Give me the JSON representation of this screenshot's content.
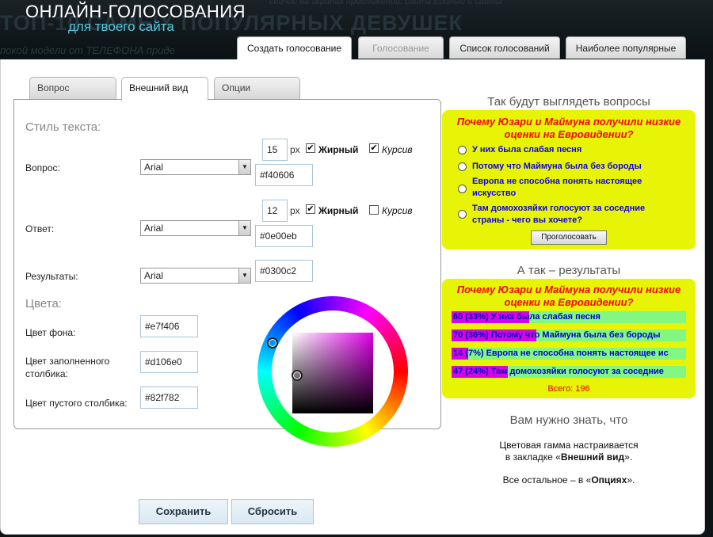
{
  "header": {
    "title": "ОНЛАЙН-ГОЛОСОВАНИЯ",
    "subtitle": "для твоего сайта",
    "bg_text": "ТОП-10 САМЫХ ПОПУЛЯРНЫХ ДЕВУШЕК",
    "bg_text2": "покой модели от ТЕЛЕФОНА приде",
    "bg_text3": "сейчас на экранах предложений: сайта Единый и сайты"
  },
  "top_tabs": [
    {
      "label": "Создать голосование",
      "state": "active"
    },
    {
      "label": "Голосование",
      "state": "disabled"
    },
    {
      "label": "Список голосований",
      "state": "normal"
    },
    {
      "label": "Наиболее популярные",
      "state": "normal"
    }
  ],
  "inner_tabs": [
    {
      "label": "Вопрос"
    },
    {
      "label": "Внешний вид"
    },
    {
      "label": "Опции"
    }
  ],
  "form": {
    "text_style_heading": "Стиль текста:",
    "px_unit": "px",
    "bold_label": "Жирный",
    "italic_label": "Курсив",
    "question": {
      "label": "Вопрос:",
      "font": "Arial",
      "size": "15",
      "color": "#f40606",
      "bold": true,
      "italic": true
    },
    "answer": {
      "label": "Ответ:",
      "font": "Arial",
      "size": "12",
      "color": "#0e00eb",
      "bold": true,
      "italic": false
    },
    "results": {
      "label": "Результаты:",
      "font": "Arial",
      "color": "#0300c2"
    },
    "colors_heading": "Цвета:",
    "bg_color": {
      "label": "Цвет фона:",
      "value": "#e7f406"
    },
    "filled_color": {
      "label": "Цвет заполненного столбика:",
      "value": "#d106e0"
    },
    "empty_color": {
      "label": "Цвет пустого столбика:",
      "value": "#82f782"
    },
    "save_label": "Сохранить",
    "reset_label": "Сбросить"
  },
  "preview": {
    "heading": "Так будут выглядеть вопросы",
    "question": "Почему Юзари и Маймуна получили низкие оценки на Евровидении?",
    "answers": [
      "У них была слабая песня",
      "Потому что Маймуна была без бороды",
      "Европа не способна понять настоящее искусство",
      "Там домохозяйки голосуют за соседние страны - чего вы хочете?"
    ],
    "vote_label": "Проголосовать"
  },
  "results_preview": {
    "heading": "А так – результаты",
    "question": "Почему Юзари и Маймуна получили низкие оценки на Евровидении?",
    "rows": [
      {
        "text": "65 (33%)  У них была слабая песня",
        "fill": 0.33
      },
      {
        "text": "70 (36%)  Потому что Маймуна была без бороды",
        "fill": 0.36
      },
      {
        "text": "14 (7%)  Европа не способна понять настоящее ис",
        "fill": 0.07
      },
      {
        "text": "47 (24%)  Там домохозяйки голосуют за соседние",
        "fill": 0.24
      }
    ],
    "total": "Всего: 196"
  },
  "info": {
    "heading": "Вам нужно знать, что",
    "line1a": "Цветовая гамма настраивается",
    "line1b_pre": "в закладке «",
    "line1b_bold": "Внешний вид",
    "line1b_post": "».",
    "line2_pre": "Все остальное – в «",
    "line2_bold": "Опциях",
    "line2_post": "»."
  },
  "colors": {
    "poll_bg": "#e7f406",
    "question_color": "#f40606",
    "answer_color": "#0e00eb",
    "result_color": "#0300c2",
    "bar_filled": "#d106e0",
    "bar_empty": "#82f782"
  }
}
